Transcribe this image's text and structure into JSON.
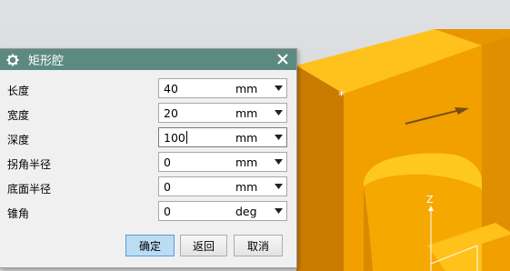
{
  "dialog": {
    "title": "矩形腔",
    "title_icon": "gear-icon",
    "close_icon": "close-icon",
    "fields": [
      {
        "label": "长度",
        "value": "40",
        "unit": "mm"
      },
      {
        "label": "宽度",
        "value": "20",
        "unit": "mm"
      },
      {
        "label": "深度",
        "value": "100",
        "unit": "mm"
      },
      {
        "label": "拐角半径",
        "value": "0",
        "unit": "mm"
      },
      {
        "label": "底面半径",
        "value": "0",
        "unit": "mm"
      },
      {
        "label": "锥角",
        "value": "0",
        "unit": "deg"
      }
    ],
    "buttons": {
      "ok": "确定",
      "back": "返回",
      "cancel": "取消"
    }
  },
  "viewport": {
    "axis_z": "Z",
    "colors": {
      "solid": "#f2a100",
      "solid_top": "#ffc21a",
      "background": "#d6d8da",
      "title_bar": "#5c8a80"
    }
  }
}
